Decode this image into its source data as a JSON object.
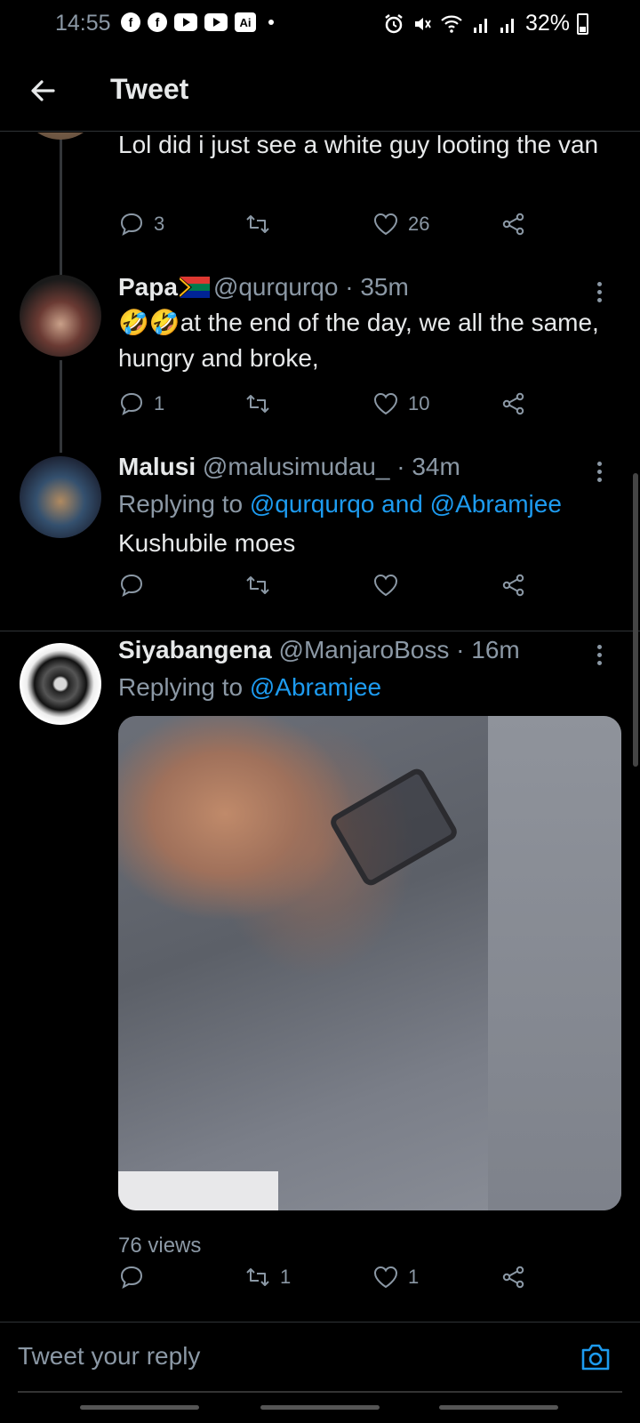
{
  "status_bar": {
    "time": "14:55",
    "battery": "32%",
    "notification_icons": [
      "facebook-icon",
      "facebook-icon",
      "youtube-icon",
      "youtube-icon",
      "ai-icon"
    ],
    "ai_label": "Ai"
  },
  "header": {
    "title": "Tweet"
  },
  "tweets": [
    {
      "text": "Lol did i just see a white guy looting the van",
      "replies": "3",
      "retweets": "",
      "likes": "26"
    },
    {
      "name": "Papa",
      "flag": "South Africa flag",
      "handle": "@qurqurqo",
      "sep": "·",
      "time": "35m",
      "text_emoji": "🤣🤣",
      "text": "at the end of the day, we all the same, hungry and broke,",
      "replies": "1",
      "retweets": "",
      "likes": "10"
    },
    {
      "name": "Malusi",
      "handle": "@malusimudau_",
      "sep": "·",
      "time": "34m",
      "replying_prefix": "Replying to ",
      "replying_to": "@qurqurqo and @Abramjee",
      "text": "Kushubile moes",
      "replies": "",
      "retweets": "",
      "likes": ""
    },
    {
      "name": "Siyabangena",
      "handle": "@ManjaroBoss",
      "sep": "·",
      "time": "16m",
      "replying_prefix": "Replying to ",
      "replying_to": "@Abramjee",
      "views": "76 views",
      "replies": "",
      "retweets": "1",
      "likes": "1"
    }
  ],
  "reply_bar": {
    "placeholder": "Tweet your reply"
  },
  "colors": {
    "background": "#000000",
    "text": "#e7e9ea",
    "secondary": "#8b98a5",
    "accent": "#1d9bf0"
  }
}
